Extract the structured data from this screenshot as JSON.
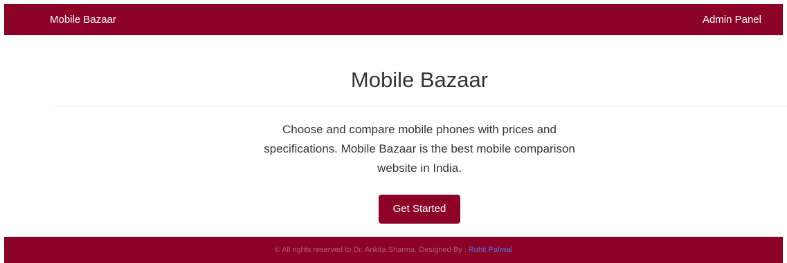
{
  "colors": {
    "brand": "#8d0328",
    "footer_link": "#5c6fd6"
  },
  "navbar": {
    "brand": "Mobile Bazaar",
    "admin_link": "Admin Panel"
  },
  "hero": {
    "title": "Mobile Bazaar",
    "description": "Choose and compare mobile phones with prices and specifications. Mobile Bazaar is the best mobile comparison website in India.",
    "button": "Get Started"
  },
  "footer": {
    "text": "© All rights reserved to Dr. Ankita Sharma. Designed By :",
    "designer": "Rohit Paliwal"
  }
}
